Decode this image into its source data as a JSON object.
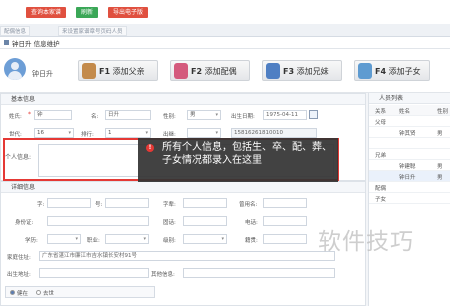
{
  "toolbar": {
    "buttons": [
      {
        "label": "查询本家谱",
        "color": "#e0503f"
      },
      {
        "label": "刷新",
        "color": "#3aa757"
      },
      {
        "label": "导出电子版",
        "color": "#e0503f"
      }
    ]
  },
  "tabs": [
    {
      "label": "配偶信息"
    },
    {
      "label": "来设置家谱章号页码人员"
    }
  ],
  "page_title": "钟日升 信息维护",
  "profile": {
    "name": "钟日升",
    "actions": [
      {
        "key": "F1",
        "label": "添加父亲",
        "color": "#c38a4b"
      },
      {
        "key": "F2",
        "label": "添加配偶",
        "color": "#d45a7d"
      },
      {
        "key": "F3",
        "label": "添加兄妹",
        "color": "#4f7fc3"
      },
      {
        "key": "F4",
        "label": "添加子女",
        "color": "#5e9bd1"
      }
    ]
  },
  "basic_info": {
    "title": "基本信息",
    "surname_label": "姓氏:",
    "surname_value": "钟",
    "name_label": "名:",
    "name_value": "日升",
    "gender_label": "性别:",
    "gender_value": "男",
    "birth_label": "出生日期:",
    "birth_value": "1975-04-11",
    "generation_label": "世代:",
    "generation_value": "16",
    "rank_label": "排行:",
    "rank_value": "1",
    "origin_label": "出继:",
    "id_value": "15816261810010",
    "personal_label": "个人信息:"
  },
  "detail_info": {
    "title": "详细信息",
    "zi_label": "字:",
    "hao_label": "号:",
    "pai_label": "字辈:",
    "former_name_label": "曾用名:",
    "id_card_label": "身份证:",
    "phone_label": "固话:",
    "tel_label": "电话:",
    "education_label": "学历:",
    "job_label": "职业:",
    "role_label": "级别:",
    "honor_label": "籍贯:",
    "address_label": "家庭住址:",
    "address_value": "广东省湛江市廉江市吉水镇长安村91号",
    "birthplace_label": "出生地址:",
    "other_label": "其他信息:",
    "status_options": [
      "健在",
      "去世"
    ]
  },
  "right_panel": {
    "title": "人员列表",
    "headers": [
      "关系",
      "姓名",
      "性别"
    ],
    "rows": [
      {
        "rel": "父母",
        "name": "",
        "sex": ""
      },
      {
        "rel": "",
        "name": "钟其贤",
        "sex": "男"
      },
      {
        "rel": "",
        "name": "",
        "sex": ""
      },
      {
        "rel": "兄弟",
        "name": "",
        "sex": ""
      },
      {
        "rel": "",
        "name": "钟建聪",
        "sex": "男"
      },
      {
        "rel": "",
        "name": "钟日升",
        "sex": "男"
      },
      {
        "rel": "配偶",
        "name": "",
        "sex": ""
      },
      {
        "rel": "子女",
        "name": "",
        "sex": ""
      }
    ]
  },
  "popup": {
    "marker": "!",
    "text": "所有个人信息，包括生、卒、配、葬、子女情况都录入在这里"
  },
  "watermark": "软件技巧"
}
